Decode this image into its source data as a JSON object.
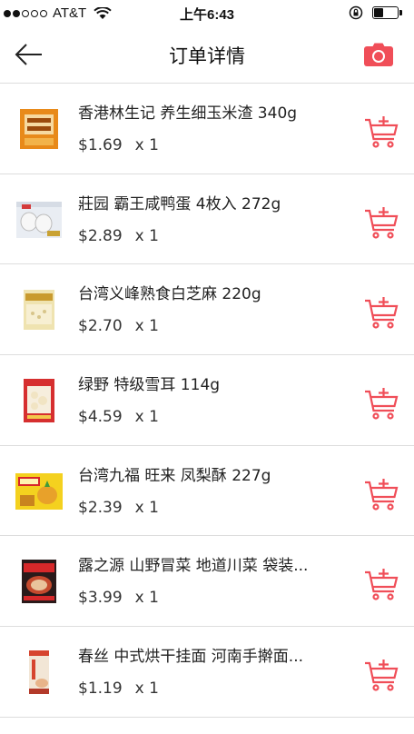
{
  "status_bar": {
    "carrier": "AT&T",
    "time": "上午6:43"
  },
  "header": {
    "title": "订单详情",
    "back_icon": "arrow-left-icon",
    "camera_icon": "camera-icon",
    "accent_color": "#f04e58"
  },
  "items": [
    {
      "title": "香港林生记 养生细玉米渣  340g",
      "price": "$1.69",
      "qty": "x 1"
    },
    {
      "title": "莊园 霸王咸鸭蛋 4枚入 272g",
      "price": "$2.89",
      "qty": "x 1"
    },
    {
      "title": "台湾义峰熟食白芝麻 220g",
      "price": "$2.70",
      "qty": "x 1"
    },
    {
      "title": "绿野 特级雪耳 114g",
      "price": "$4.59",
      "qty": "x 1"
    },
    {
      "title": "台湾九福 旺来 凤梨酥 227g",
      "price": "$2.39",
      "qty": "x 1"
    },
    {
      "title": "露之源 山野冒菜 地道川菜 袋装...",
      "price": "$3.99",
      "qty": "x 1"
    },
    {
      "title": "春丝 中式烘干挂面 河南手擀面...",
      "price": "$1.19",
      "qty": "x 1"
    }
  ],
  "cart_icon": "add-to-cart-icon"
}
